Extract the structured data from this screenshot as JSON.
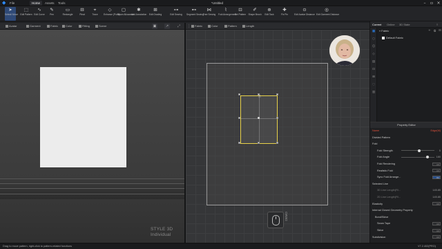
{
  "titlebar": {
    "menus": [
      "File",
      "Home",
      "Assets",
      "Tools"
    ],
    "doc_title": "*Untitled"
  },
  "toolbar": {
    "tools": [
      {
        "label": "Select/ Move",
        "icon": "select-icon"
      },
      {
        "label": "Edit Pattern",
        "icon": "edit-pattern-icon"
      },
      {
        "label": "Edit Curve",
        "icon": "edit-curve-icon"
      },
      {
        "label": "Pen",
        "icon": "pen-icon"
      },
      {
        "label": "Rectangle",
        "icon": "rectangle-icon"
      },
      {
        "label": "Pleat",
        "icon": "pleat-icon"
      },
      {
        "label": "Trace",
        "icon": "trace-icon"
      },
      {
        "label": "Enhance (Point)",
        "icon": "enhance-icon"
      },
      {
        "label": "Seam Allowance",
        "icon": "seam-allowance-icon"
      },
      {
        "label": "Add Annotation",
        "icon": "annotation-icon"
      },
      {
        "label": "Edit Grading",
        "icon": "grading-icon"
      },
      {
        "label": "Edit Sewing",
        "icon": "edit-sewing-icon"
      },
      {
        "label": "Segment Sewing",
        "icon": "segment-sewing-icon"
      },
      {
        "label": "Free Sewing",
        "icon": "free-sewing-icon"
      },
      {
        "label": "Fold Arrangement",
        "icon": "fold-arrangement-icon"
      },
      {
        "label": "Set Pattern",
        "icon": "set-pattern-icon"
      },
      {
        "label": "Shape Brush",
        "icon": "shape-brush-icon"
      },
      {
        "label": "Edit Tack",
        "icon": "edit-tack-icon"
      },
      {
        "label": "Fix Pin",
        "icon": "fix-pin-icon"
      },
      {
        "label": "Edit Avatar Distance",
        "icon": "avatar-distance-icon"
      },
      {
        "label": "Edit Garment Distance",
        "icon": "garment-distance-icon"
      }
    ]
  },
  "view3d": {
    "tabs": [
      "Avatar",
      "Garment",
      "Fabric",
      "Color",
      "Fitting",
      "Scene"
    ],
    "brand_line1": "STYLE 3D",
    "brand_line2": "Individual"
  },
  "view2d": {
    "tabs": [
      "Fabric",
      "Color",
      "Pattern",
      "Length"
    ],
    "demo_label": "DEMO"
  },
  "object_browser": {
    "tabs": [
      "Current",
      "Online",
      "3D State"
    ],
    "root": "Fabric",
    "items": [
      "Default Fabric"
    ]
  },
  "property_editor": {
    "title": "Property Editor",
    "rows": [
      {
        "label": "Name",
        "value": "Edge(M)",
        "style": "hl"
      },
      {
        "label": "Divided Pattern",
        "value": ""
      },
      {
        "label": "Fold",
        "value": ""
      },
      {
        "label": "Fold Strength",
        "value": "5"
      },
      {
        "label": "Fold Angle",
        "value": "180"
      },
      {
        "label": "Fold Rendering",
        "value": "Off"
      },
      {
        "label": "Realistic Fold",
        "value": "Off"
      },
      {
        "label": "Sync Fold Arrange...",
        "value": "On"
      },
      {
        "label": "Selected Line",
        "value": ""
      },
      {
        "label": "3D Line Length(Fil...",
        "value": "145.85"
      },
      {
        "label": "2D Line Length(Fil...",
        "value": "145.85"
      },
      {
        "label": "Elasticity",
        "value": "Off"
      },
      {
        "label": "Internal Closed Geometry Property",
        "value": ""
      },
      {
        "label": "Bond/Skive",
        "value": ""
      },
      {
        "label": "Seam Tape",
        "value": "Off"
      },
      {
        "label": "Skive",
        "value": "Off"
      },
      {
        "label": "Subdivision",
        "value": "Off"
      }
    ],
    "fold_strength_fraction": 0.55,
    "fold_angle_fraction": 0.8
  },
  "status": {
    "text": "Drag to move pattern, right-click to pattern-related functions",
    "version": "V7.2.402(PRO)"
  },
  "colors": {
    "accent": "#2d8cff",
    "selection": "#e8d24a",
    "highlight": "#e0503a"
  }
}
